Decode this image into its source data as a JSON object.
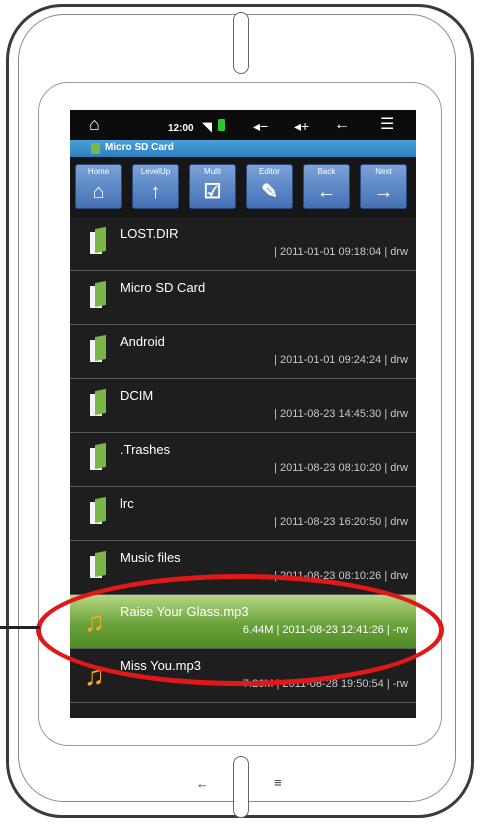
{
  "status_bar": {
    "time": "12:00"
  },
  "path_bar": {
    "title": "Micro SD Card"
  },
  "toolbar": {
    "buttons": [
      {
        "label": "Home",
        "icon": "home-icon"
      },
      {
        "label": "LevelUp",
        "icon": "arrow-up-icon"
      },
      {
        "label": "Multi",
        "icon": "checkbox-icon"
      },
      {
        "label": "Editor",
        "icon": "pencil-icon"
      },
      {
        "label": "Back",
        "icon": "arrow-left-icon"
      },
      {
        "label": "Next",
        "icon": "arrow-right-icon"
      }
    ]
  },
  "files": [
    {
      "name": "LOST.DIR",
      "meta": "| 2011-01-01 09:18:04 | drw",
      "type": "folder"
    },
    {
      "name": "Micro SD Card",
      "meta": "",
      "type": "folder"
    },
    {
      "name": "Android",
      "meta": "| 2011-01-01 09:24:24 | drw",
      "type": "folder"
    },
    {
      "name": "DCIM",
      "meta": "| 2011-08-23 14:45:30 | drw",
      "type": "folder"
    },
    {
      "name": ".Trashes",
      "meta": "| 2011-08-23 08:10:20 | drw",
      "type": "folder"
    },
    {
      "name": "lrc",
      "meta": "| 2011-08-23 16:20:50 | drw",
      "type": "folder"
    },
    {
      "name": "Music files",
      "meta": "| 2011-08-23 08:10:26 | drw",
      "type": "folder"
    },
    {
      "name": "Raise Your Glass.mp3",
      "meta": "6.44M | 2011-08-23 12:41:26 | -rw",
      "type": "music",
      "selected": true
    },
    {
      "name": "Miss You.mp3",
      "meta": "7.26M | 2011-08-28 19:50:54 | -rw",
      "type": "music"
    }
  ],
  "colors": {
    "selection_green": "#6aa33b",
    "highlight_ring": "#e01818",
    "path_blue": "#2c7fbd",
    "folder_green": "#7ab648",
    "music_orange": "#f5a623"
  }
}
